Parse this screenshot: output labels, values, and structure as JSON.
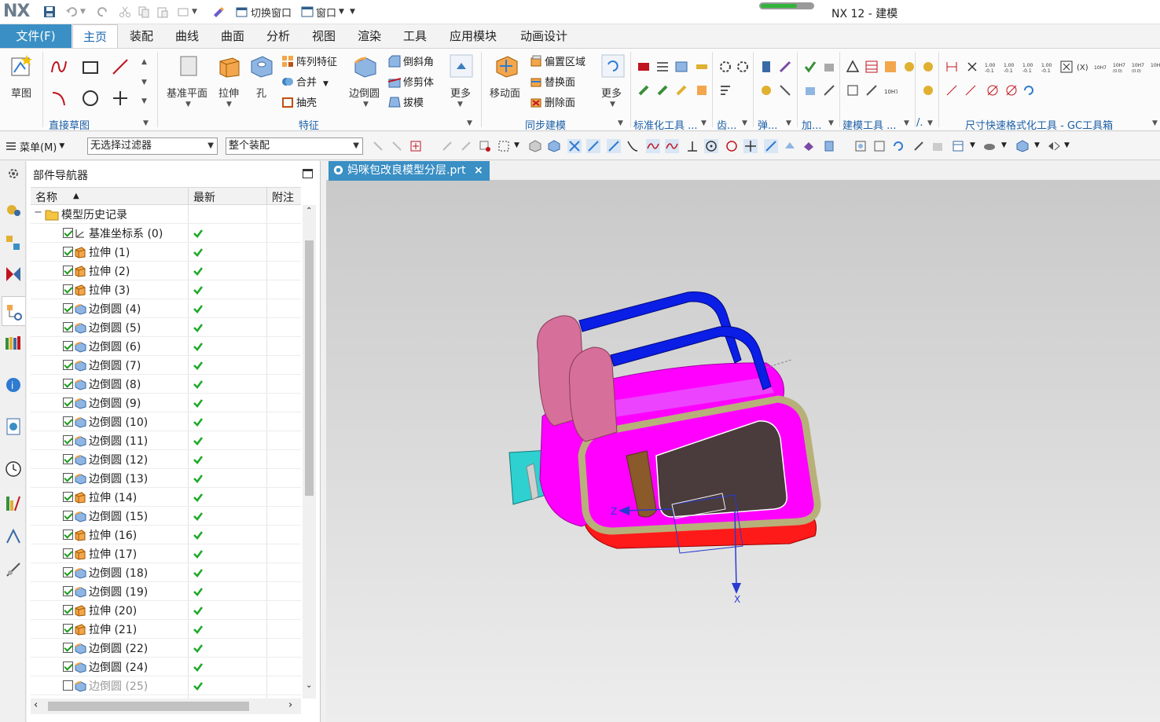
{
  "app": {
    "logo": "NX",
    "title": "NX 12 - 建模",
    "quick_access": {
      "switch_window": "切换窗口",
      "window_menu": "窗口"
    },
    "progress_value": 0.7
  },
  "ribbon_tabs": {
    "file": "文件(F)",
    "tabs": [
      "主页",
      "装配",
      "曲线",
      "曲面",
      "分析",
      "视图",
      "渲染",
      "工具",
      "应用模块",
      "动画设计"
    ],
    "active": "主页"
  },
  "ribbon": {
    "sketch_label": "草图",
    "group_direct_sketch": "直接草图",
    "datum_plane": "基准平面",
    "extrude": "拉伸",
    "hole": "孔",
    "pattern_feature": "阵列特征",
    "unite": "合并",
    "shell": "抽壳",
    "edge_blend": "边倒圆",
    "chamfer": "倒斜角",
    "trim_body": "修剪体",
    "draft": "拔模",
    "more": "更多",
    "group_feature": "特征",
    "move_face": "移动面",
    "offset_region": "偏置区域",
    "replace_face": "替换面",
    "delete_face": "删除面",
    "group_sync": "同步建模",
    "group_standard": "标准化工具 ...",
    "group_gear": "齿...",
    "group_spring": "弹...",
    "group_add": "加...",
    "group_modeling_tools": "建模工具 ...",
    "group_dot": "/.",
    "group_gc": "尺寸快速格式化工具 - GC工具箱"
  },
  "cmdbar": {
    "menu": "菜单(M)",
    "filter": "无选择过滤器",
    "scope": "整个装配"
  },
  "navigator": {
    "title": "部件导航器",
    "columns": [
      "名称",
      "最新",
      "附注"
    ],
    "root": "模型历史记录",
    "rows": [
      {
        "label": "基准坐标系 (0)",
        "type": "datum",
        "checked": true
      },
      {
        "label": "拉伸 (1)",
        "type": "extrude",
        "checked": true
      },
      {
        "label": "拉伸 (2)",
        "type": "extrude",
        "checked": true
      },
      {
        "label": "拉伸 (3)",
        "type": "extrude",
        "checked": true
      },
      {
        "label": "边倒圆 (4)",
        "type": "blend",
        "checked": true
      },
      {
        "label": "边倒圆 (5)",
        "type": "blend",
        "checked": true
      },
      {
        "label": "边倒圆 (6)",
        "type": "blend",
        "checked": true
      },
      {
        "label": "边倒圆 (7)",
        "type": "blend",
        "checked": true
      },
      {
        "label": "边倒圆 (8)",
        "type": "blend",
        "checked": true
      },
      {
        "label": "边倒圆 (9)",
        "type": "blend",
        "checked": true
      },
      {
        "label": "边倒圆 (10)",
        "type": "blend",
        "checked": true
      },
      {
        "label": "边倒圆 (11)",
        "type": "blend",
        "checked": true
      },
      {
        "label": "边倒圆 (12)",
        "type": "blend",
        "checked": true
      },
      {
        "label": "边倒圆 (13)",
        "type": "blend",
        "checked": true
      },
      {
        "label": "拉伸 (14)",
        "type": "extrude",
        "checked": true
      },
      {
        "label": "边倒圆 (15)",
        "type": "blend",
        "checked": true
      },
      {
        "label": "拉伸 (16)",
        "type": "extrude",
        "checked": true
      },
      {
        "label": "拉伸 (17)",
        "type": "extrude",
        "checked": true
      },
      {
        "label": "边倒圆 (18)",
        "type": "blend",
        "checked": true
      },
      {
        "label": "边倒圆 (19)",
        "type": "blend",
        "checked": true
      },
      {
        "label": "拉伸 (20)",
        "type": "extrude",
        "checked": true
      },
      {
        "label": "拉伸 (21)",
        "type": "extrude",
        "checked": true
      },
      {
        "label": "边倒圆 (22)",
        "type": "blend",
        "checked": true
      },
      {
        "label": "边倒圆 (24)",
        "type": "blend",
        "checked": true
      },
      {
        "label": "边倒圆 (25)",
        "type": "blend",
        "checked": false
      }
    ]
  },
  "document": {
    "tab": "妈咪包改良模型分层.prt",
    "axis_z": "Z",
    "axis_x": "X"
  },
  "colors": {
    "accent": "#3a8fc4",
    "body_magenta": "#ff00ff",
    "handle_blue": "#0a1ee6",
    "base_red": "#ff1a1a",
    "rim_olive": "#b8b07a",
    "strap_cyan": "#2ed0d0",
    "pad_pink": "#d6709a",
    "panel_dark": "#4a3c3c"
  }
}
